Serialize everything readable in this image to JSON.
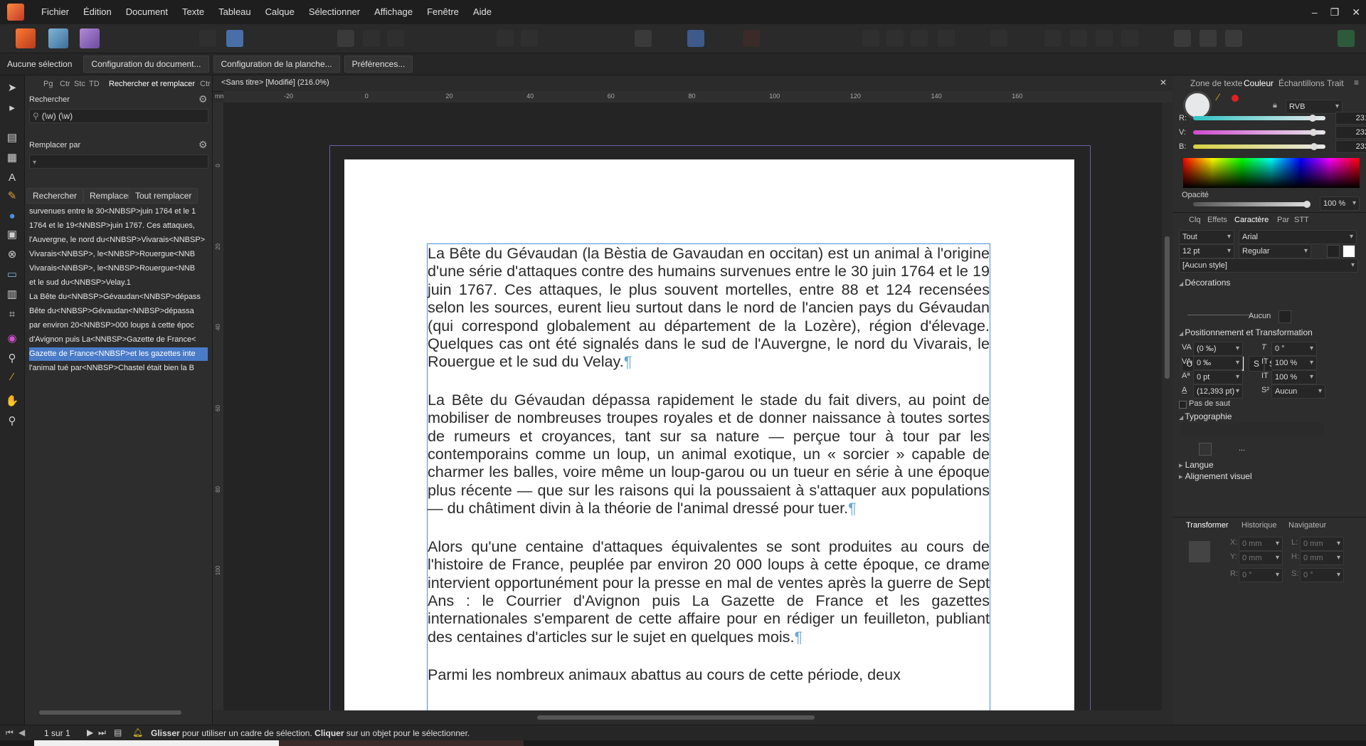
{
  "menu": [
    "Fichier",
    "Édition",
    "Document",
    "Texte",
    "Tableau",
    "Calque",
    "Sélectionner",
    "Affichage",
    "Fenêtre",
    "Aide"
  ],
  "window_controls": {
    "minimize": "–",
    "restore": "❐",
    "close": "✕"
  },
  "context": {
    "selection": "Aucune sélection",
    "buttons": [
      "Configuration du document...",
      "Configuration de la planche...",
      "Préférences..."
    ]
  },
  "left_panel": {
    "tabs": [
      "Pg",
      "Ctr",
      "Stc",
      "TD",
      "Rechercher et remplacer",
      "Ctr"
    ],
    "find_label": "Rechercher",
    "find_value": "(\\w) (\\w)",
    "replace_label": "Remplacer par",
    "buttons": [
      "Rechercher",
      "Remplacer",
      "Tout remplacer"
    ],
    "results": [
      "survenues entre le 30<NNBSP>juin 1764 et le 1",
      "1764 et le 19<NNBSP>juin 1767. Ces attaques,",
      "l'Auvergne, le nord du<NNBSP>Vivarais<NNBSP>",
      "Vivarais<NNBSP>, le<NNBSP>Rouergue<NNB",
      "Vivarais<NNBSP>, le<NNBSP>Rouergue<NNB",
      "et le sud du<NNBSP>Velay.1",
      "La Bête du<NNBSP>Gévaudan<NNBSP>dépass",
      "Bête du<NNBSP>Gévaudan<NNBSP>dépassa",
      "par environ 20<NNBSP>000 loups à cette époc",
      "d'Avignon puis La<NNBSP>Gazette de France<",
      "Gazette de France<NNBSP>et les gazettes inte",
      "l'animal tué par<NNBSP>Chastel était bien la B"
    ],
    "selected_result": 10
  },
  "document": {
    "tab_title": "<Sans titre> [Modifié] (216.0%)",
    "close": "✕",
    "ruler_unit": "mm",
    "ruler_ticks": [
      "-20",
      "0",
      "20",
      "40",
      "60",
      "80",
      "100",
      "120",
      "140",
      "160"
    ],
    "ruler_left_ticks": [
      "0",
      "20",
      "40",
      "60",
      "80",
      "100"
    ],
    "paragraphs": [
      "La Bête du Gévaudan (la Bèstia de Gavaudan en occitan) est un animal à l'origine d'une série d'attaques contre des humains survenues entre le 30 juin 1764 et le 19 juin 1767. Ces attaques, le plus souvent mortelles, entre 88 et 124 recensées selon les sources, eurent lieu surtout dans le nord de l'ancien pays du Gévaudan (qui correspond globalement au département de la Lozère), région d'élevage. Quelques cas ont été signalés dans le sud de l'Auvergne, le nord du Vivarais, le Rouergue et le sud du Velay.",
      "La Bête du Gévaudan dépassa rapidement le stade du fait divers, au point de mobiliser de nombreuses troupes royales et de donner naissance à toutes sortes de rumeurs et croyances, tant sur sa nature — perçue tour à tour par les contemporains comme un loup, un animal exotique, un « sorcier » capable de charmer les balles, voire même un loup-garou ou un tueur en série à une époque plus récente — que sur les raisons qui la poussaient à s'attaquer aux populations — du châtiment divin à la théorie de l'animal dressé pour tuer.",
      "Alors qu'une centaine d'attaques équivalentes se sont produites au cours de l'histoire de France, peuplée par environ 20 000 loups à cette époque, ce drame intervient opportunément pour la presse en mal de ventes après la guerre de Sept Ans : le Courrier d'Avignon puis La Gazette de France et les gazettes internationales s'emparent de cette affaire pour en rédiger un feuilleton, publiant des centaines d'articles sur le sujet en quelques mois.",
      "Parmi les nombreux animaux abattus au cours de cette période, deux"
    ],
    "pilcrow": "¶"
  },
  "right_panel": {
    "top_tabs": [
      "Zone de texte",
      "Couleur",
      "Échantillons",
      "Trait"
    ],
    "color_model": "RVB",
    "rgb": {
      "r": "231",
      "v": "232",
      "b": "233"
    },
    "rgb_values": {
      "r": 231,
      "v": 232,
      "b": 233
    },
    "rgb_labels": {
      "r": "R:",
      "v": "V:",
      "b": "B:"
    },
    "opacity_label": "Opacité",
    "opacity": "100 %",
    "opacity_value": 100,
    "char_tabs": [
      "Clq",
      "Effets",
      "Caractère",
      "Par",
      "STT"
    ],
    "font_scope": "Tout",
    "font_family": "Arial",
    "font_size": "12 pt",
    "font_style": "Regular",
    "char_style": "[Aucun style]",
    "decorations_label": "Décorations",
    "decoration_none": "Aucun",
    "positioning_label": "Positionnement et Transformation",
    "tracking": "(0 ‰)",
    "kerning": "0 ‰",
    "baseline": "0 pt",
    "leading": "(12,393 pt)",
    "skew": "0 °",
    "vscale": "100 %",
    "hscale": "100 %",
    "script": "Aucun",
    "nobreak_label": "Pas de saut",
    "typography_label": "Typographie",
    "more": "...",
    "language_label": "Langue",
    "visual_align_label": "Alignement visuel",
    "bottom_tabs": [
      "Transformer",
      "Historique",
      "Navigateur"
    ],
    "transform": {
      "x": "0 mm",
      "y": "0 mm",
      "w": "0 mm",
      "h": "0 mm",
      "r": "0 °",
      "s": "0 °"
    },
    "transform_labels": {
      "x": "X:",
      "y": "Y:",
      "w": "L:",
      "h": "H:",
      "r": "R:",
      "s": "S:"
    }
  },
  "status": {
    "page": "1 sur 1",
    "hint_bold1": "Glisser",
    "hint1": " pour utiliser un cadre de sélection. ",
    "hint_bold2": "Cliquer",
    "hint2": " sur un objet pour le sélectionner."
  },
  "colors": {
    "accent": "#4a7bc8",
    "text_frame": "#4a8fd9",
    "spread_border": "#6a5fa8",
    "slider_r": "#e64a4a",
    "slider_v": "#d04ad0",
    "slider_b": "#d8d040"
  }
}
